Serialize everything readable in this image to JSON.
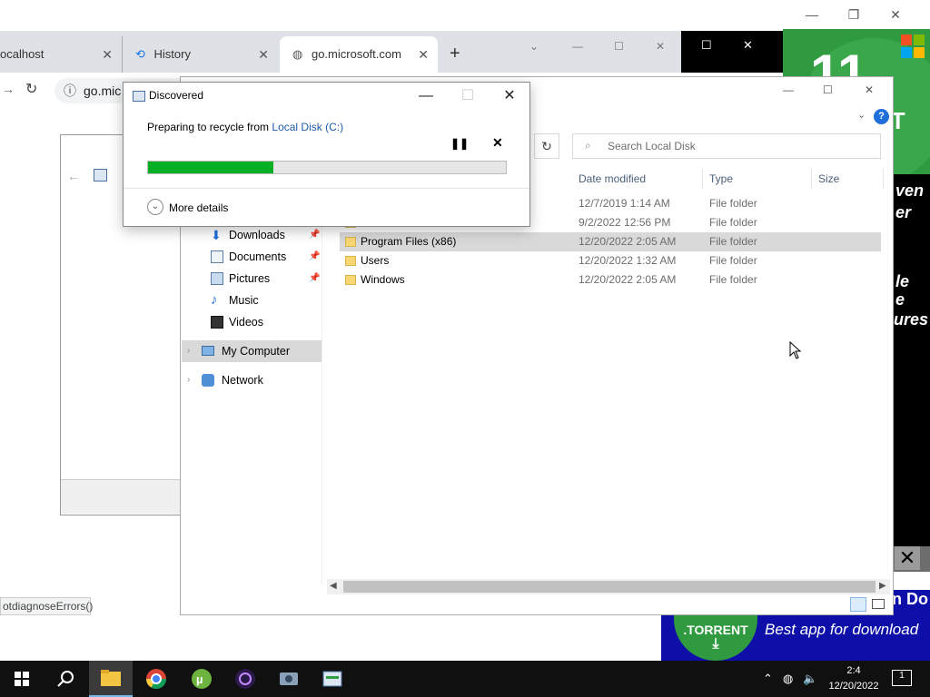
{
  "browser": {
    "tabs": [
      {
        "label": "ocalhost"
      },
      {
        "label": "History"
      },
      {
        "label": "go.microsoft.com"
      }
    ],
    "new_tab": "+",
    "address": "go.mic",
    "status_text": "otdiagnoseErrors()"
  },
  "dialog": {
    "title": "Discovered",
    "message_prefix": "Preparing to recycle from ",
    "message_link": "Local Disk (C:)",
    "progress": 0.35,
    "more_details": "More details"
  },
  "explorer": {
    "search_placeholder": "Search Local Disk",
    "columns": [
      "Date modified",
      "Type",
      "Size"
    ],
    "nav": [
      {
        "label": "Downloads",
        "pinned": true
      },
      {
        "label": "Documents",
        "pinned": true
      },
      {
        "label": "Pictures",
        "pinned": true
      },
      {
        "label": "Music",
        "pinned": false
      },
      {
        "label": "Videos",
        "pinned": false
      },
      {
        "label": "My Computer",
        "pinned": false
      },
      {
        "label": "Network",
        "pinned": false
      }
    ],
    "rows": [
      {
        "name": "",
        "date": "12/7/2019 1:14 AM",
        "type": "File folder"
      },
      {
        "name": "",
        "date": "9/2/2022 12:56 PM",
        "type": "File folder"
      },
      {
        "name": "Program Files (x86)",
        "date": "12/20/2022 2:05 AM",
        "type": "File folder",
        "selected": true
      },
      {
        "name": "Users",
        "date": "12/20/2022 1:32 AM",
        "type": "File folder"
      },
      {
        "name": "Windows",
        "date": "12/20/2022 2:05 AM",
        "type": "File folder"
      }
    ]
  },
  "ad": {
    "side_text": [
      "ven",
      "er",
      "e",
      "le",
      "ures"
    ],
    "torrent_label": ".TORRENT",
    "tagline": "Best app for download",
    "do_text": "n Do",
    "close": "✕",
    "brand_colors": {
      "green": "#2f9a3f",
      "blue": "#0e0ea8"
    }
  },
  "taskbar": {
    "time": "2:4",
    "date": "12/20/2022",
    "notification_count": "1"
  }
}
